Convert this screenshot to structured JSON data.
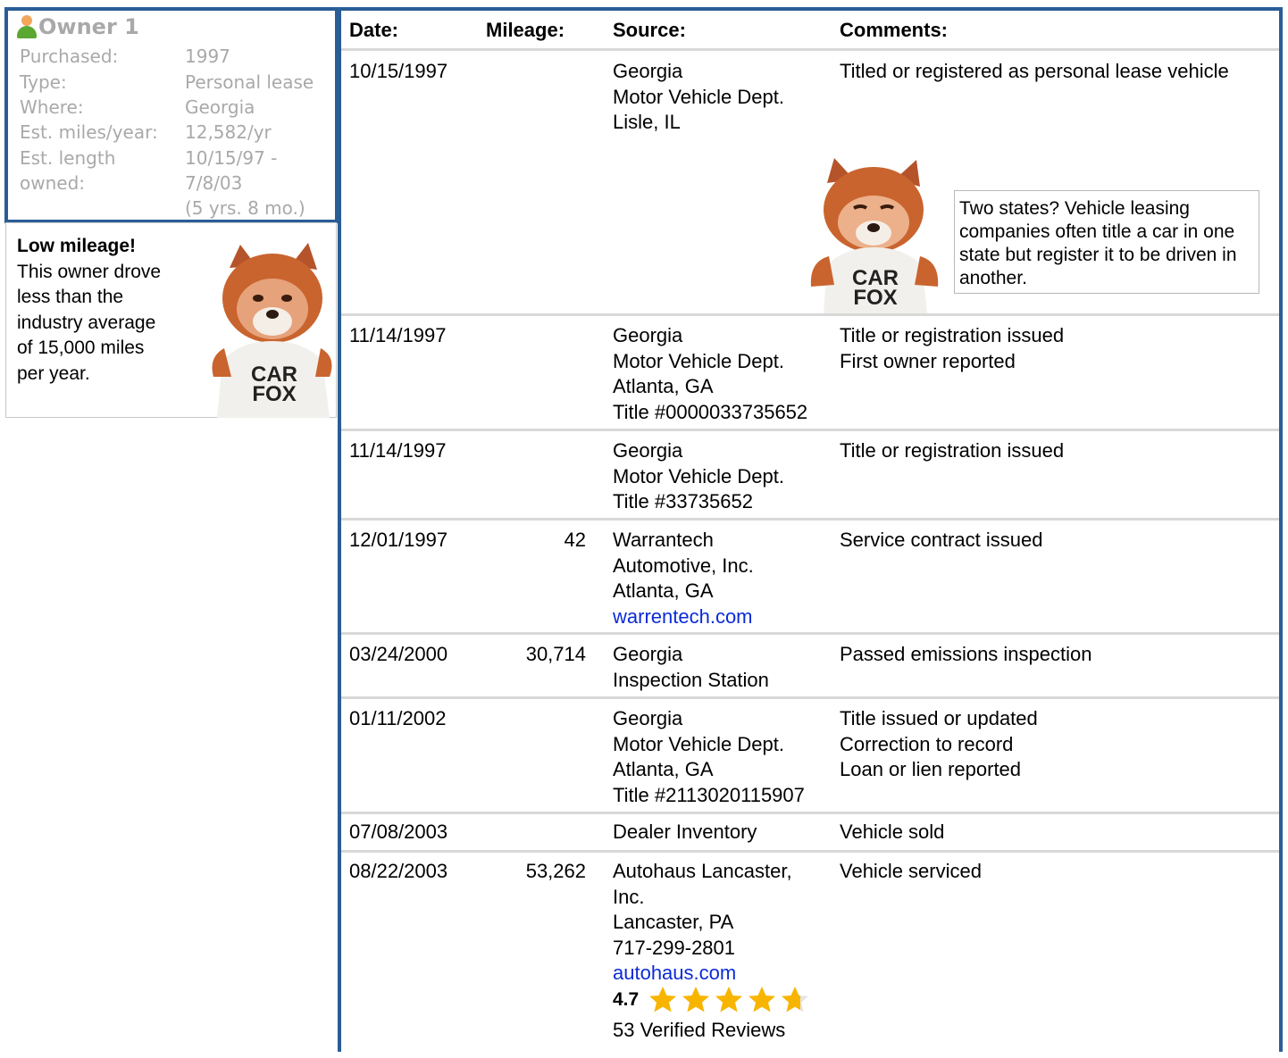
{
  "owner": {
    "title": "Owner 1",
    "rows": [
      {
        "label": "Purchased:",
        "value": "1997"
      },
      {
        "label": "Type:",
        "value": "Personal lease"
      },
      {
        "label": "Where:",
        "value": "Georgia"
      },
      {
        "label": "Est. miles/year:",
        "value": "12,582/yr"
      },
      {
        "label": "Est. length",
        "value": "10/15/97 -"
      },
      {
        "label": "owned:",
        "value": "7/8/03"
      },
      {
        "label": "",
        "value": "(5 yrs. 8 mo.)"
      }
    ]
  },
  "low_mileage": {
    "title": "Low mileage!",
    "lines": [
      "This owner drove",
      "less than the",
      "industry average",
      "of 15,000 miles",
      "per year."
    ]
  },
  "fox_shirt": {
    "line1": "CAR",
    "line2": "FOX"
  },
  "table": {
    "headers": {
      "date": "Date:",
      "mileage": "Mileage:",
      "source": "Source:",
      "comments": "Comments:"
    },
    "rows": [
      {
        "date": "10/15/1997",
        "mileage": "",
        "source": [
          "Georgia",
          "Motor Vehicle Dept.",
          "Lisle, IL"
        ],
        "comments": [
          "Titled or registered as personal lease vehicle"
        ]
      },
      {
        "date": "11/14/1997",
        "mileage": "",
        "source": [
          "Georgia",
          "Motor Vehicle Dept.",
          "Atlanta, GA",
          "Title #0000033735652"
        ],
        "comments": [
          "Title or registration issued",
          "First owner reported"
        ]
      },
      {
        "date": "11/14/1997",
        "mileage": "",
        "source": [
          "Georgia",
          "Motor Vehicle Dept.",
          "Title #33735652"
        ],
        "comments": [
          "Title or registration issued"
        ]
      },
      {
        "date": "12/01/1997",
        "mileage": "42",
        "source": [
          "Warrantech",
          "Automotive, Inc.",
          "Atlanta, GA"
        ],
        "source_link": "warrentech.com",
        "comments": [
          "Service contract issued"
        ]
      },
      {
        "date": "03/24/2000",
        "mileage": "30,714",
        "source": [
          "Georgia",
          "Inspection Station"
        ],
        "comments": [
          "Passed emissions inspection"
        ]
      },
      {
        "date": "01/11/2002",
        "mileage": "",
        "source": [
          "Georgia",
          "Motor Vehicle Dept.",
          "Atlanta, GA",
          "Title #2113020115907"
        ],
        "comments": [
          "Title issued or updated",
          "Correction to record",
          "Loan or lien reported"
        ]
      },
      {
        "date": "07/08/2003",
        "mileage": "",
        "source": [
          "Dealer Inventory"
        ],
        "comments": [
          "Vehicle sold"
        ]
      },
      {
        "date": "08/22/2003",
        "mileage": "53,262",
        "source": [
          "Autohaus Lancaster,",
          "Inc.",
          "Lancaster, PA",
          "717-299-2801"
        ],
        "source_link": "autohaus.com",
        "comments": [
          "Vehicle serviced"
        ]
      }
    ]
  },
  "tip": {
    "text": "Two states? Vehicle leasing companies often title a car in one state but register it to be driven in another."
  },
  "rating": {
    "value": "4.7",
    "stars": 4.7,
    "reviews": "53 Verified Reviews"
  },
  "colors": {
    "border": "#2a5d96",
    "link": "#0b2bd6",
    "star": "#f7b500",
    "muted": "#a9a9a9"
  }
}
